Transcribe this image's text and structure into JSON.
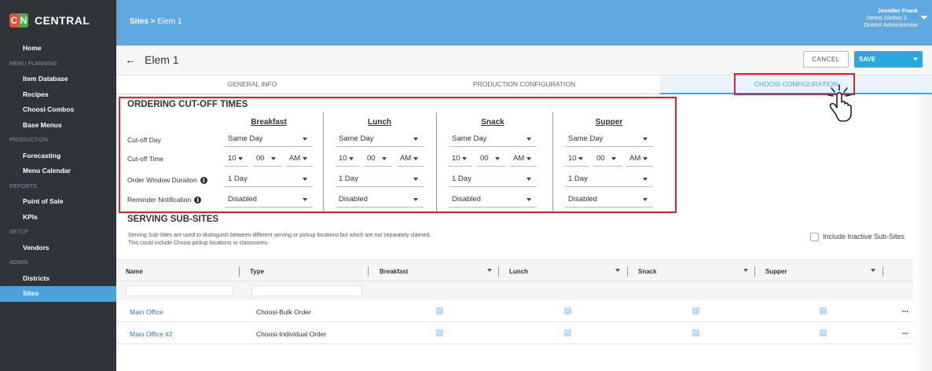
{
  "app": {
    "logo_c": "C",
    "logo_n": "N",
    "logo_text": "CENTRAL"
  },
  "sidebar": {
    "items": [
      {
        "type": "item",
        "label": "Home"
      },
      {
        "type": "section",
        "label": "MENU PLANNING"
      },
      {
        "type": "item",
        "label": "Item Database"
      },
      {
        "type": "item",
        "label": "Recipes"
      },
      {
        "type": "item",
        "label": "Choosi Combos"
      },
      {
        "type": "item",
        "label": "Base Menus"
      },
      {
        "type": "section",
        "label": "PRODUCTION"
      },
      {
        "type": "item",
        "label": "Forecasting"
      },
      {
        "type": "item",
        "label": "Menu Calendar"
      },
      {
        "type": "section",
        "label": "REPORTS"
      },
      {
        "type": "item",
        "label": "Point of Sale"
      },
      {
        "type": "item",
        "label": "KPIs"
      },
      {
        "type": "section",
        "label": "SETUP"
      },
      {
        "type": "item",
        "label": "Vendors"
      },
      {
        "type": "section",
        "label": "ADMIN"
      },
      {
        "type": "item",
        "label": "Districts"
      },
      {
        "type": "item",
        "label": "Sites",
        "active": true
      }
    ]
  },
  "topbar": {
    "crumb_root": "Sites",
    "crumb_sep": ">",
    "crumb_current": "Elem 1"
  },
  "user": {
    "name": "Jennifer Frank",
    "district": "Demo District 1",
    "role": "District Administrator"
  },
  "page": {
    "back_icon": "←",
    "title": "Elem 1",
    "cancel": "CANCEL",
    "save": "SAVE"
  },
  "tabs": [
    "GENERAL INFO",
    "PRODUCTION CONFIGURATION",
    "CHOOSI CONFIGURATION"
  ],
  "cutoff": {
    "title": "ORDERING CUT-OFF TIMES",
    "row_labels": [
      "Cut-off Day",
      "Cut-off Time",
      "Order Window Duration",
      "Reminder Notification"
    ],
    "meals": [
      {
        "name": "Breakfast",
        "day": "Same Day",
        "hour": "10",
        "minute": "00",
        "ampm": "AM",
        "duration": "1 Day",
        "reminder": "Disabled"
      },
      {
        "name": "Lunch",
        "day": "Same Day",
        "hour": "10",
        "minute": "00",
        "ampm": "AM",
        "duration": "1 Day",
        "reminder": "Disabled"
      },
      {
        "name": "Snack",
        "day": "Same Day",
        "hour": "10",
        "minute": "00",
        "ampm": "AM",
        "duration": "1 Day",
        "reminder": "Disabled"
      },
      {
        "name": "Supper",
        "day": "Same Day",
        "hour": "10",
        "minute": "00",
        "ampm": "AM",
        "duration": "1 Day",
        "reminder": "Disabled"
      }
    ]
  },
  "subsites": {
    "title": "SERVING SUB-SITES",
    "desc1": "Serving Sub-Sites are used to distinguish between different serving or pickup locations but which are not separately claimed.",
    "desc2": "This could include Choosi pickup locations or classrooms.",
    "include_inactive": "Include Inactive Sub-Sites",
    "columns": [
      "Name",
      "Type",
      "Breakfast",
      "Lunch",
      "Snack",
      "Supper"
    ],
    "rows": [
      {
        "name": "Main Office",
        "type": "Choosi-Bulk Order",
        "more": "..."
      },
      {
        "name": "Main Office #2",
        "type": "Choosi-Individual Order",
        "more": "..."
      }
    ]
  },
  "colors": {
    "accent": "#5fa9e0",
    "highlight_box": "#e0212d",
    "sidebar_bg": "#2f3439"
  }
}
